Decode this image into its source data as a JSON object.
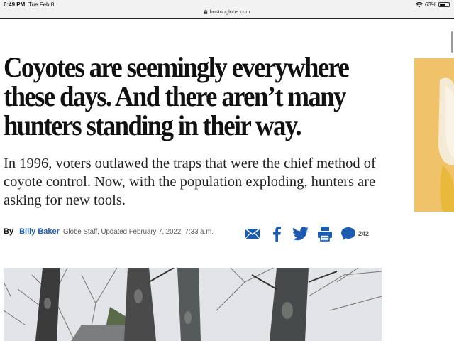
{
  "status_bar": {
    "time": "6:49 PM",
    "date": "Tue Feb 8",
    "battery": "63%",
    "battery_level": 0.63,
    "url": "bostonglobe.com"
  },
  "article": {
    "headline": "Coyotes are seemingly everywhere these days. And there aren’t many hunters standing in their way.",
    "subhead": "In 1996, voters outlawed the traps that were the chief method of coyote control. Now, with the population exploding, hunters are asking for new tools.",
    "byline": {
      "by": "By",
      "author": "Billy Baker",
      "meta": "Globe Staff, Updated February 7, 2022, 7:33 a.m."
    },
    "share": {
      "icons": [
        "email-icon",
        "facebook-icon",
        "twitter-icon",
        "print-icon",
        "comment-icon"
      ],
      "comment_count": "242"
    }
  },
  "colors": {
    "brand_blue": "#1b5bb0",
    "ad_background": "#f0c36a"
  }
}
